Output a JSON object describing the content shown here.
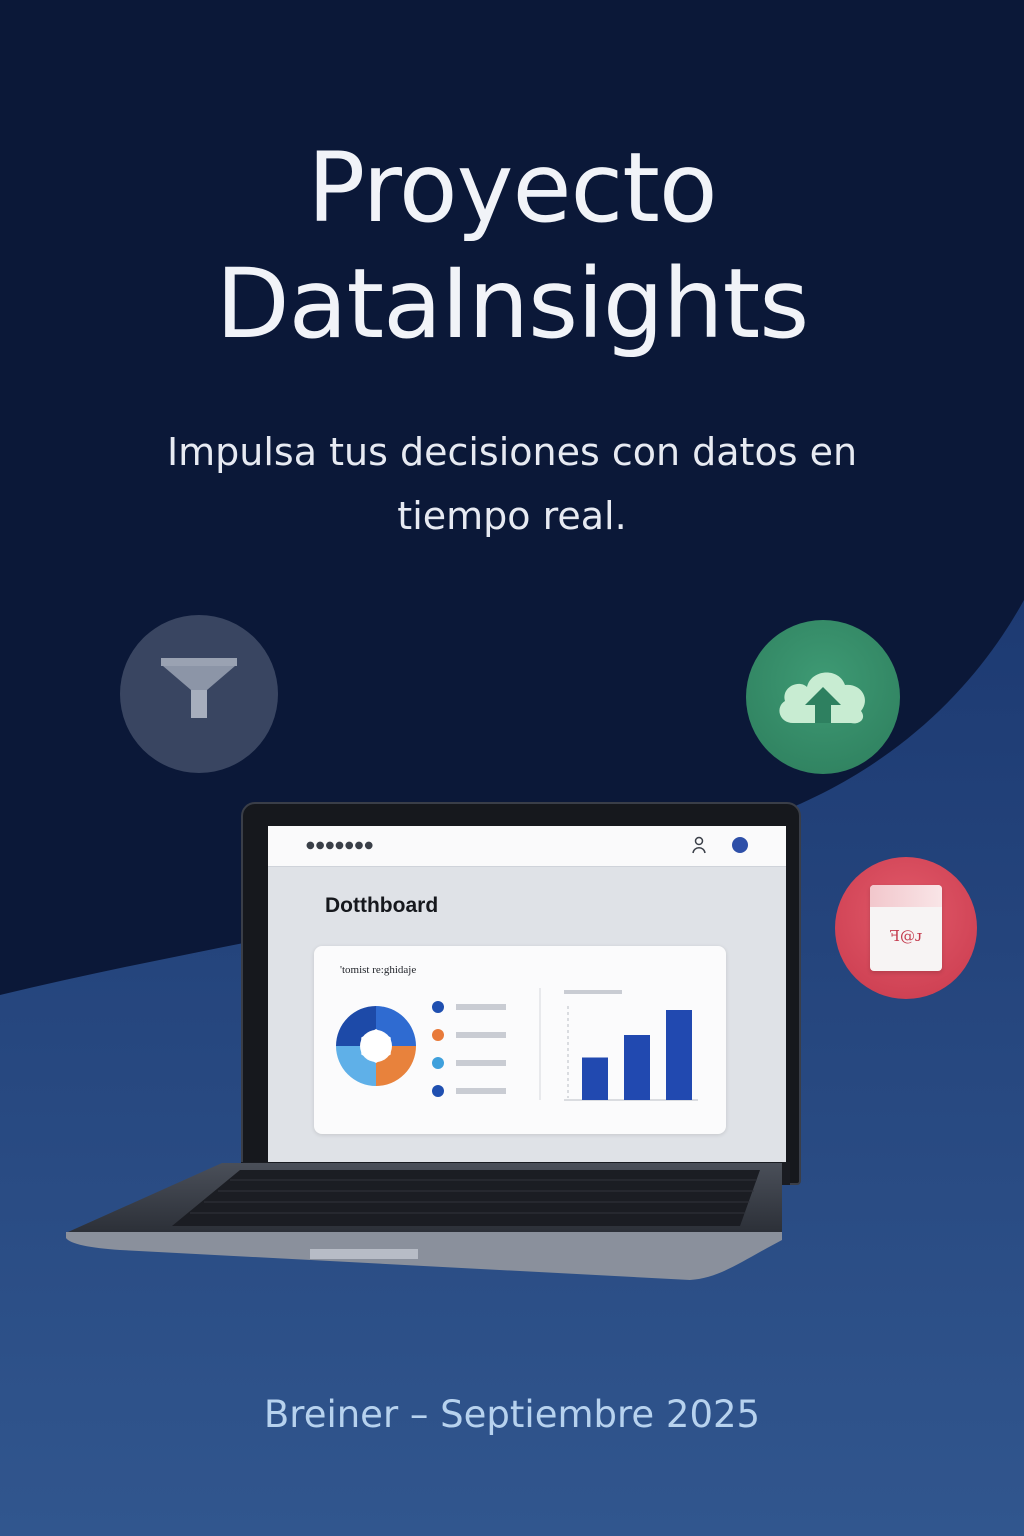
{
  "title": {
    "line1": "Proyecto",
    "line2": "DataInsights"
  },
  "subtitle": "Impulsa tus decisiones con datos en tiempo real.",
  "icons": {
    "filter": "filter-icon",
    "cloud": "cloud-upload-icon",
    "document": "document-icon",
    "document_text": "ꟻ@ᴊ"
  },
  "dashboard": {
    "toolbar_dots": "●●●●●●●",
    "title": "Dotthboard",
    "card_label": "'tomist re:ghidaje",
    "legend_colors": [
      "#1f4fb0",
      "#e87a3a",
      "#3fa0dc",
      "#1f4fb0"
    ],
    "donut_colors": [
      "#2f6bd1",
      "#e8823c",
      "#5fb0e8",
      "#1d4aa8"
    ],
    "bar_values": [
      1.7,
      2.6,
      3.6
    ],
    "bar_color": "#2149b0"
  },
  "footer": "Breiner – Septiembre 2025",
  "colors": {
    "bg_dark": "#0b1838",
    "bg_wave": "#22407a",
    "footer_text": "#b7d2ee"
  }
}
